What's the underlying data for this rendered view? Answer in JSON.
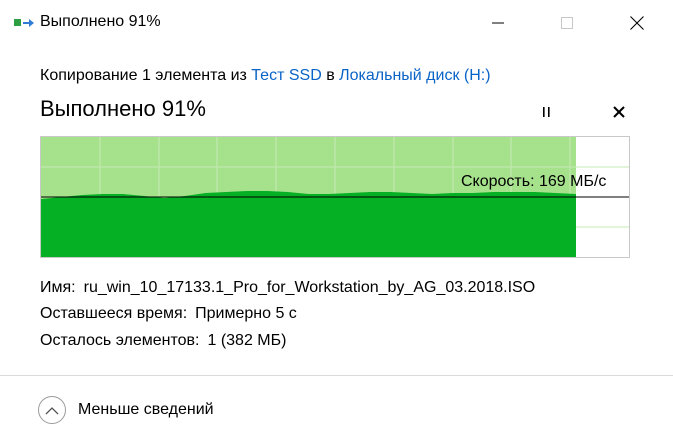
{
  "window": {
    "title": "Выполнено 91%",
    "icons": {
      "app": "copy-files-icon",
      "minimize": "minimize-icon",
      "maximize": "maximize-icon",
      "close": "close-icon"
    }
  },
  "description": {
    "prefix": "Копирование 1 элемента из ",
    "source": "Тест SSD",
    "middle": " в ",
    "destination": "Локальный диск (H:)"
  },
  "progress": {
    "title": "Выполнено 91%",
    "percent": 91,
    "pause_icon": "pause-icon",
    "stop_icon": "stop-icon",
    "speed_label": "Скорость: 169 МБ/с"
  },
  "details": {
    "name_label": "Имя:",
    "name_value": "ru_win_10_17133.1_Pro_for_Workstation_by_AG_03.2018.ISO",
    "time_label": "Оставшееся время:",
    "time_value": "Примерно 5 с",
    "items_label": "Осталось элементов:",
    "items_value": "1 (382 МБ)"
  },
  "footer": {
    "less_details": "Меньше сведений",
    "chevron_icon": "chevron-up-icon"
  },
  "colors": {
    "link": "#0a64c8",
    "graph_done_bg": "#a6e28c",
    "graph_fill": "#06b025",
    "grid": "#c6e9b6"
  }
}
